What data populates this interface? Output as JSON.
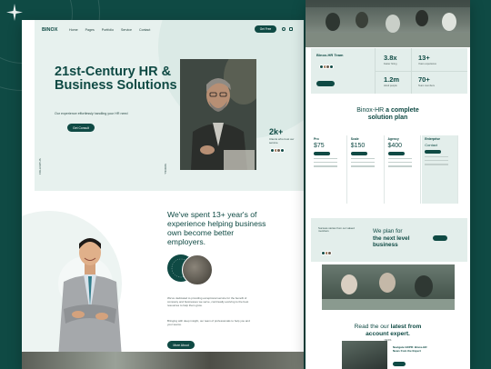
{
  "brand": {
    "logo": "BINOX"
  },
  "nav": {
    "items": [
      "Home",
      "Pages",
      "Portfolio",
      "Service",
      "Contact"
    ],
    "cta": "Get Free"
  },
  "hero": {
    "title": "21st-Century HR & Business Solutions",
    "subtitle": "Our experience effortlessly handling your HR need",
    "button": "Get Consult",
    "vertical_left": "FOLLOW US",
    "vertical_right": "SCROLL",
    "stat_value": "2k+",
    "stat_label": "Clients who trust our service"
  },
  "about": {
    "title": "We've spent 13+ year's of experience helping business own become better employers.",
    "para1": "We've dedicated to providing exceptional service for the benefit of company and businesses we serve, continually evolving to the best resources to help them grow.",
    "para2": "Bringing with deep insight, our team of professionals to help you and your teams.",
    "button": "More About"
  },
  "right": {
    "stats_title": "Binox-HR Team",
    "stats": [
      {
        "value": "3.8x",
        "label": "Faster hiring"
      },
      {
        "value": "13+",
        "label": "Years experience"
      },
      {
        "value": "1.2m",
        "label": "Hired people"
      },
      {
        "value": "70+",
        "label": "Team members"
      }
    ],
    "plans_title_a": "Binox-HR",
    "plans_title_b": "a complete",
    "plans_title_c": "solution plan",
    "plans": [
      {
        "name": "Pro",
        "price": "$75"
      },
      {
        "name": "Scale",
        "price": "$150"
      },
      {
        "name": "Agency",
        "price": "$400"
      },
      {
        "name": "Enterprise",
        "price": "Contact"
      }
    ],
    "plan_for_title_a": "We plan for",
    "plan_for_title_b": "the next level",
    "plan_for_title_c": "business",
    "plan_for_side": "Success stories from our valued members",
    "blog_title_a": "Read the our",
    "blog_title_b": "latest from",
    "blog_title_c": "account expert.",
    "blog_tag": "NEWS",
    "blog_post": "Navigate GDPR: Binox-HR News from the Expert"
  },
  "colors": {
    "primary": "#0f4a44",
    "tint": "#e3eeeb",
    "page_bg": "#0f4a44"
  }
}
